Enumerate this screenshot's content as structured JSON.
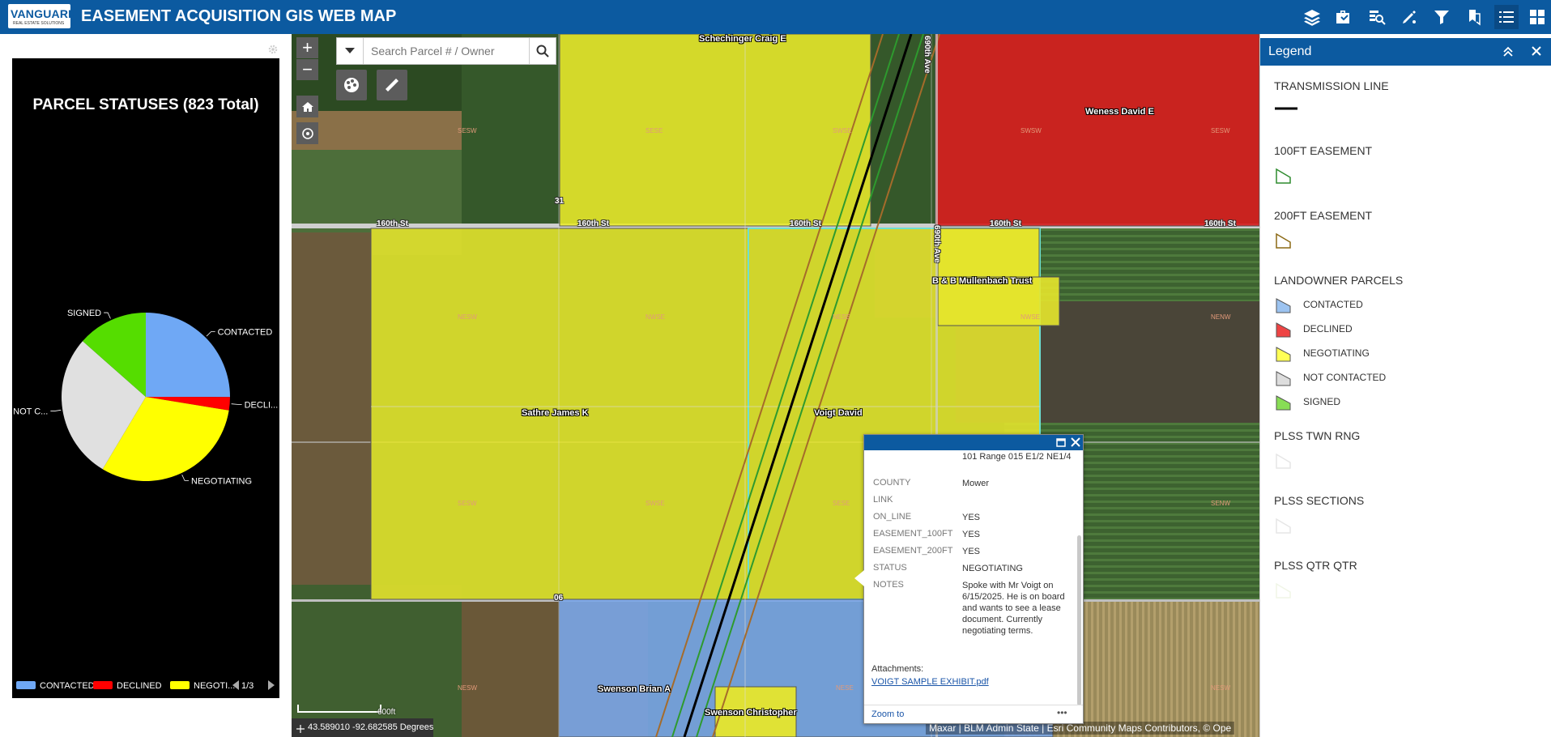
{
  "header": {
    "logo_text": "VANGUARD",
    "logo_sub": "REAL ESTATE SOLUTIONS",
    "title": "EASEMENT ACQUISITION GIS WEB MAP",
    "tools": [
      "layers-icon",
      "briefcase-icon",
      "query-icon",
      "draw-icon",
      "filter-icon",
      "bookmark-icon",
      "legend-icon",
      "widgets-icon"
    ]
  },
  "chart_data": {
    "type": "pie",
    "title": "PARCEL STATUSES (823 Total)",
    "slice_labels": [
      "CONTACTED",
      "DECLI...",
      "NEGOTIATING",
      "NOT C...",
      "SIGNED"
    ],
    "categories": [
      "CONTACTED",
      "DECLINED",
      "NEGOTIATING",
      "NOT CONTACTED",
      "SIGNED"
    ],
    "values": [
      206,
      21,
      255,
      230,
      111
    ],
    "colors": [
      "#6fa8f5",
      "#ff0000",
      "#ffff00",
      "#e0e0e0",
      "#55dd00"
    ],
    "legend": {
      "items": [
        "CONTACTED",
        "DECLINED",
        "NEGOTI..."
      ],
      "page": "1/3",
      "placement": "bottom"
    }
  },
  "search": {
    "placeholder": "Search Parcel # / Owner"
  },
  "map": {
    "parcel_labels": [
      "Schechinger Craig E",
      "Weness David E",
      "B & B Mullenbach Trust",
      "Sathre James K",
      "Voigt David",
      "Swenson Brian A",
      "Swenson Christopher"
    ],
    "road_labels": [
      "160th St",
      "160th St",
      "160th St",
      "160th St",
      "160th St",
      "690th Ave",
      "690th Ave",
      "31",
      "06"
    ],
    "qq_labels": [
      "SESW",
      "SESE",
      "SWSE",
      "SWSW",
      "SESW",
      "NESW",
      "NWSE",
      "NESE",
      "NWSE",
      "NENW",
      "SESW",
      "SWSE",
      "SESE",
      "SENW",
      "NESW",
      "NESE",
      "NESW"
    ],
    "coordinates": "43.589010 -92.682585 Degrees",
    "attribution": "Maxar | BLM Admin State | Esri Community Maps Contributors, © Ope",
    "scale_label": "600ft"
  },
  "popup": {
    "rows": [
      {
        "key": "",
        "value": "101 Range 015 E1/2 NE1/4"
      },
      {
        "key": "COUNTY",
        "value": "Mower"
      },
      {
        "key": "LINK",
        "value": ""
      },
      {
        "key": "ON_LINE",
        "value": "YES"
      },
      {
        "key": "EASEMENT_100FT",
        "value": "YES"
      },
      {
        "key": "EASEMENT_200FT",
        "value": "YES"
      },
      {
        "key": "STATUS",
        "value": "NEGOTIATING"
      },
      {
        "key": "NOTES",
        "value": "Spoke with Mr Voigt on 6/15/2025. He is on board and wants to see a lease document. Currently negotiating terms."
      }
    ],
    "attachments_label": "Attachments:",
    "attachment_link": "VOIGT SAMPLE EXHIBIT.pdf",
    "zoom_to": "Zoom to",
    "more": "•••"
  },
  "legend": {
    "title": "Legend",
    "layers": [
      {
        "name": "TRANSMISSION LINE",
        "items": [
          {
            "label": "",
            "symbol": "line",
            "color": "#000000"
          }
        ]
      },
      {
        "name": "100FT EASEMENT",
        "items": [
          {
            "label": "",
            "symbol": "outline",
            "color": "#2e8b2e"
          }
        ]
      },
      {
        "name": "200FT EASEMENT",
        "items": [
          {
            "label": "",
            "symbol": "outline",
            "color": "#8b6914"
          }
        ]
      },
      {
        "name": "LANDOWNER PARCELS",
        "items": [
          {
            "label": "CONTACTED",
            "symbol": "fill",
            "color": "#9cc3f0"
          },
          {
            "label": "DECLINED",
            "symbol": "fill",
            "color": "#ee4444"
          },
          {
            "label": "NEGOTIATING",
            "symbol": "fill",
            "color": "#ffff55"
          },
          {
            "label": "NOT CONTACTED",
            "symbol": "fill",
            "color": "#dddddd"
          },
          {
            "label": "SIGNED",
            "symbol": "fill",
            "color": "#88dd55"
          }
        ]
      },
      {
        "name": "PLSS TWN RNG",
        "items": [
          {
            "label": "",
            "symbol": "outline",
            "color": "#e6e6e6"
          }
        ]
      },
      {
        "name": "PLSS SECTIONS",
        "items": [
          {
            "label": "",
            "symbol": "outline",
            "color": "#e6e6e6"
          }
        ]
      },
      {
        "name": "PLSS QTR QTR",
        "items": [
          {
            "label": "",
            "symbol": "outline",
            "color": "#f0f5e6"
          }
        ]
      }
    ]
  }
}
